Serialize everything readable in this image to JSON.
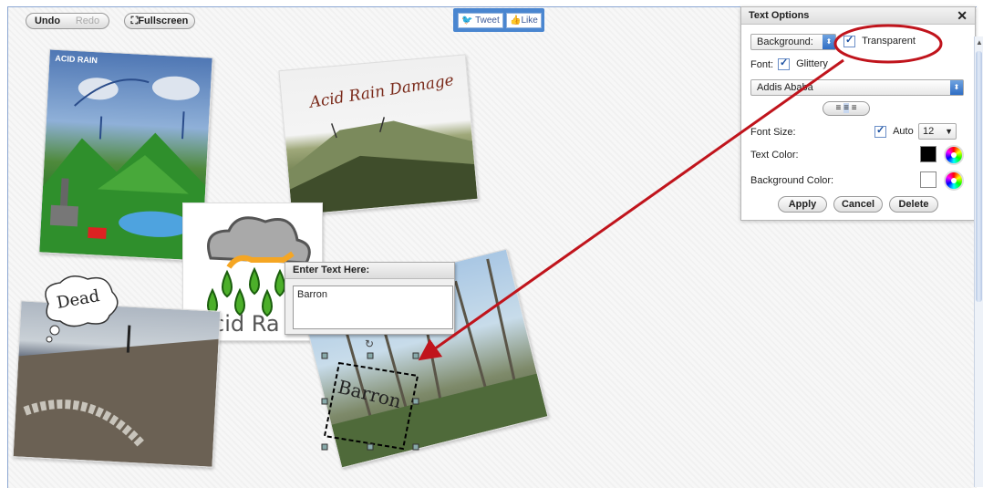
{
  "toolbar": {
    "undo_label": "Undo",
    "redo_label": "Redo",
    "fullscreen_label": "Fullscreen"
  },
  "social": {
    "tweet_label": "Tweet",
    "like_label": "Like"
  },
  "photos": {
    "acid_rain_diagram_title": "ACID RAIN",
    "mountain_caption": "Acid Rain Damage",
    "cloud_caption": "Acid Ra",
    "dead_bubble": "Dead",
    "forest_text": "Barron"
  },
  "text_options": {
    "title": "Text Options",
    "close": "✕",
    "background_select": "Background:",
    "transparent_label": "Transparent",
    "font_label": "Font:",
    "glittery_label": "Glittery",
    "font_select": "Addis Ababa",
    "font_size_label": "Font Size:",
    "auto_label": "Auto",
    "font_size_value": "12",
    "text_color_label": "Text Color:",
    "background_color_label": "Background Color:",
    "apply_label": "Apply",
    "cancel_label": "Cancel",
    "delete_label": "Delete",
    "text_color": "#000000",
    "background_color": "#ffffff"
  },
  "text_entry": {
    "title": "Enter Text Here:",
    "value": "Barron"
  },
  "annotation_color": "#c0141c"
}
